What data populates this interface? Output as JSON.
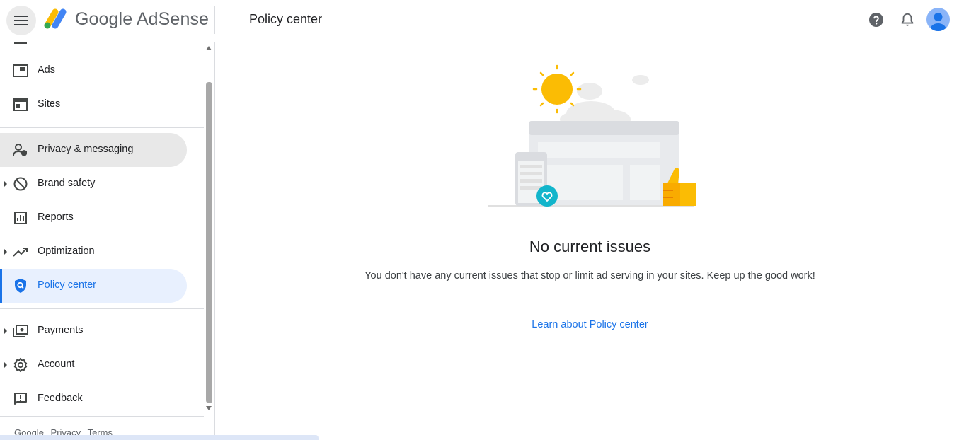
{
  "header": {
    "app_name": "Google AdSense",
    "page_title": "Policy center"
  },
  "sidebar": {
    "items": [
      {
        "label": "Ads",
        "icon": "ads-icon"
      },
      {
        "label": "Sites",
        "icon": "sites-icon"
      },
      {
        "label": "Privacy & messaging",
        "icon": "privacy-icon"
      },
      {
        "label": "Brand safety",
        "icon": "block-icon"
      },
      {
        "label": "Reports",
        "icon": "reports-icon"
      },
      {
        "label": "Optimization",
        "icon": "trending-icon"
      },
      {
        "label": "Policy center",
        "icon": "shield-icon"
      },
      {
        "label": "Payments",
        "icon": "payments-icon"
      },
      {
        "label": "Account",
        "icon": "gear-icon"
      },
      {
        "label": "Feedback",
        "icon": "feedback-icon"
      }
    ],
    "footer": {
      "google": "Google",
      "privacy": "Privacy",
      "terms": "Terms"
    }
  },
  "main": {
    "title": "No current issues",
    "description": "You don't have any current issues that stop or limit ad serving in your sites. Keep up the good work!",
    "link": "Learn about Policy center"
  },
  "colors": {
    "accent": "#1a73e8",
    "active_bg": "#e8f0fe",
    "hover_bg": "#e8e8e8"
  }
}
